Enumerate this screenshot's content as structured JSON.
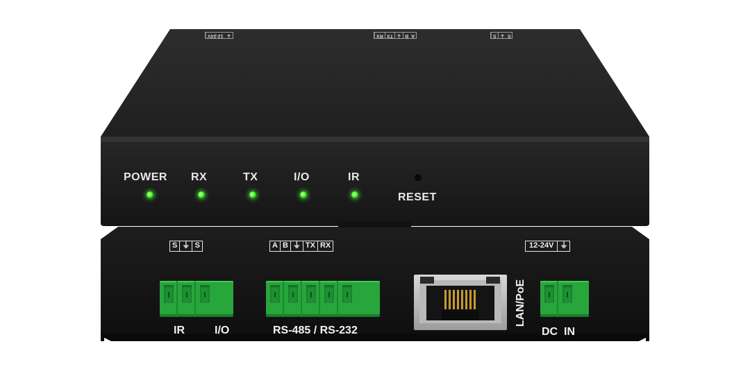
{
  "front_panel": {
    "leds": [
      {
        "label": "POWER",
        "color": "#3fe22a"
      },
      {
        "label": "RX",
        "color": "#3fe22a"
      },
      {
        "label": "TX",
        "color": "#3fe22a"
      },
      {
        "label": "I/O",
        "color": "#3fe22a"
      },
      {
        "label": "IR",
        "color": "#3fe22a"
      }
    ],
    "reset_label": "RESET"
  },
  "rear_panel": {
    "pin_groups": [
      {
        "pins": [
          "S",
          "⏚",
          "S"
        ]
      },
      {
        "pins": [
          "A",
          "B",
          "⏚",
          "TX",
          "RX"
        ]
      },
      {
        "pins": [
          "12-24V",
          "⏚"
        ]
      }
    ],
    "port_labels": {
      "ir": "IR",
      "io": "I/O",
      "rs485": "RS-485 / RS-232",
      "lan": "LAN/PoE",
      "dc": "DC  IN"
    }
  },
  "top_labels": {
    "left": [
      "12-24V",
      "⏚"
    ],
    "center": [
      "RX",
      "TX",
      "⏚",
      "B",
      "A"
    ],
    "right": [
      "S",
      "⏚",
      "S"
    ]
  },
  "colors": {
    "chassis": "#1c1c1c",
    "terminal_green": "#27a63b",
    "led_green": "#3fe22a",
    "label_white": "#e8e8e8"
  }
}
